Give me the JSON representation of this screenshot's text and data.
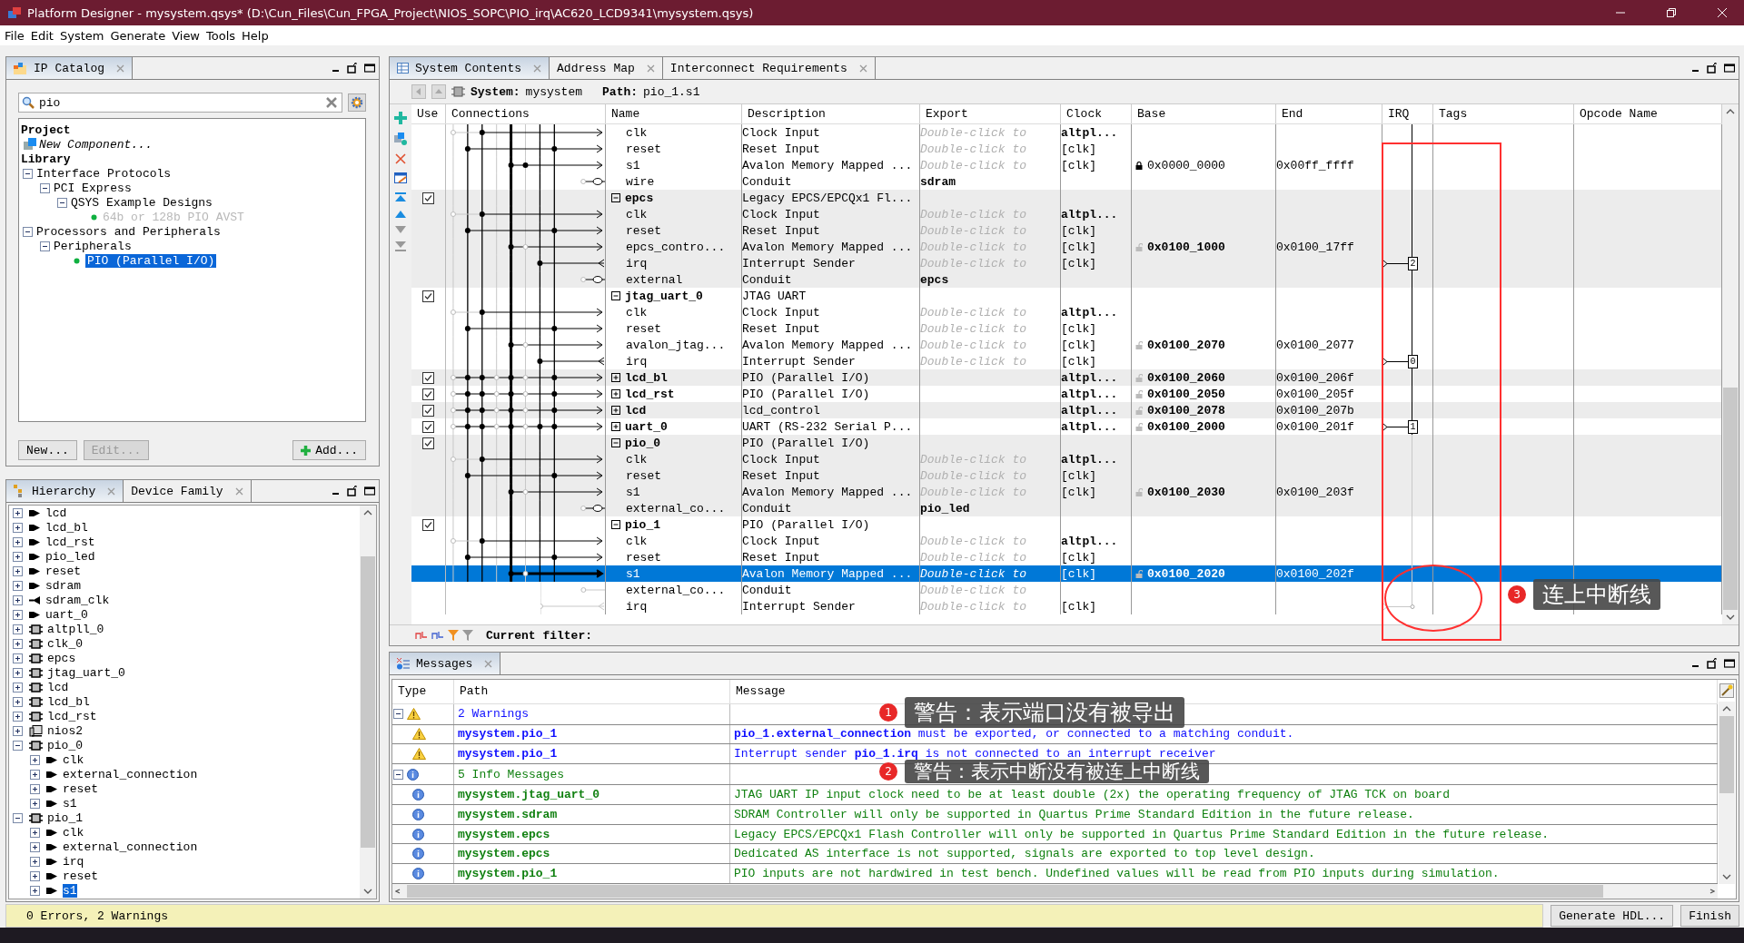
{
  "window": {
    "title": "Platform Designer - mysystem.qsys* (D:\\Cun_Files\\Cun_FPGA_Project\\NIOS_SOPC\\PIO_irq\\AC620_LCD9341\\mysystem.qsys)"
  },
  "menu": [
    "File",
    "Edit",
    "System",
    "Generate",
    "View",
    "Tools",
    "Help"
  ],
  "ip_catalog": {
    "tab": "IP Catalog",
    "search": {
      "value": "pio"
    },
    "tree": [
      {
        "label": "Project",
        "kind": "heading",
        "children": [
          {
            "label": "New Component...",
            "kind": "new"
          }
        ]
      },
      {
        "label": "Library",
        "kind": "heading",
        "children": [
          {
            "label": "Interface Protocols",
            "kind": "folder",
            "expanded": true,
            "children": [
              {
                "label": "PCI Express",
                "kind": "folder",
                "expanded": true,
                "children": [
                  {
                    "label": "QSYS Example Designs",
                    "kind": "folder",
                    "expanded": true,
                    "children": [
                      {
                        "label": "64b or 128b PIO AVST",
                        "kind": "ip",
                        "disabled": true,
                        "selected": false
                      }
                    ]
                  }
                ]
              }
            ]
          },
          {
            "label": "Processors and Peripherals",
            "kind": "folder",
            "expanded": true,
            "children": [
              {
                "label": "Peripherals",
                "kind": "folder",
                "expanded": true,
                "children": [
                  {
                    "label": "PIO (Parallel I/O)",
                    "kind": "ip",
                    "disabled": false,
                    "selected": true
                  }
                ]
              }
            ]
          }
        ]
      }
    ],
    "buttons": [
      {
        "label": "New...",
        "kind": "plain",
        "disabled": false
      },
      {
        "label": "Edit...",
        "kind": "plain",
        "disabled": true
      },
      {
        "label": "Add...",
        "kind": "add",
        "disabled": false
      }
    ]
  },
  "hierarchy": {
    "tabs": [
      {
        "label": "Hierarchy",
        "selected": true
      },
      {
        "label": "Device Family",
        "selected": false
      }
    ],
    "items": [
      {
        "label": "lcd",
        "kind": "export_in",
        "expanded": false,
        "selected": false
      },
      {
        "label": "lcd_bl",
        "kind": "export_in",
        "expanded": false,
        "selected": false
      },
      {
        "label": "lcd_rst",
        "kind": "export_in",
        "expanded": false,
        "selected": false
      },
      {
        "label": "pio_led",
        "kind": "export_in",
        "expanded": false,
        "selected": false
      },
      {
        "label": "reset",
        "kind": "export_in",
        "expanded": false,
        "selected": false
      },
      {
        "label": "sdram",
        "kind": "export_in",
        "expanded": false,
        "selected": false
      },
      {
        "label": "sdram_clk",
        "kind": "export_out",
        "expanded": false,
        "selected": false
      },
      {
        "label": "uart_0",
        "kind": "export_in",
        "expanded": false,
        "selected": false
      },
      {
        "label": "altpll_0",
        "kind": "module",
        "expanded": false,
        "selected": false
      },
      {
        "label": "clk_0",
        "kind": "module",
        "expanded": false,
        "selected": false
      },
      {
        "label": "epcs",
        "kind": "module",
        "expanded": false,
        "selected": false
      },
      {
        "label": "jtag_uart_0",
        "kind": "module",
        "expanded": false,
        "selected": false
      },
      {
        "label": "lcd",
        "kind": "module",
        "expanded": false,
        "selected": false
      },
      {
        "label": "lcd_bl",
        "kind": "module",
        "expanded": false,
        "selected": false
      },
      {
        "label": "lcd_rst",
        "kind": "module",
        "expanded": false,
        "selected": false
      },
      {
        "label": "nios2",
        "kind": "cpu",
        "expanded": false,
        "selected": false
      },
      {
        "label": "pio_0",
        "kind": "module",
        "expanded": true,
        "selected": false,
        "children": [
          {
            "label": "clk",
            "kind": "export_in",
            "expanded": false,
            "selected": false
          },
          {
            "label": "external_connection",
            "kind": "export_in",
            "expanded": false,
            "selected": false
          },
          {
            "label": "reset",
            "kind": "export_in",
            "expanded": false,
            "selected": false
          },
          {
            "label": "s1",
            "kind": "export_in",
            "expanded": false,
            "selected": false
          }
        ]
      },
      {
        "label": "pio_1",
        "kind": "module",
        "expanded": true,
        "selected": false,
        "children": [
          {
            "label": "clk",
            "kind": "export_in",
            "expanded": false,
            "selected": false
          },
          {
            "label": "external_connection",
            "kind": "export_in",
            "expanded": false,
            "selected": false
          },
          {
            "label": "irq",
            "kind": "export_in",
            "expanded": false,
            "selected": false
          },
          {
            "label": "reset",
            "kind": "export_in",
            "expanded": false,
            "selected": false
          },
          {
            "label": "s1",
            "kind": "export_in",
            "expanded": false,
            "selected": true
          }
        ]
      }
    ]
  },
  "system": {
    "tabs": [
      {
        "label": "System Contents",
        "selected": true
      },
      {
        "label": "Address Map",
        "selected": false
      },
      {
        "label": "Interconnect Requirements",
        "selected": false
      }
    ],
    "system_label": "System:",
    "system_name": "mysystem",
    "path_label": "Path:",
    "path": "pio_1.s1",
    "columns": [
      "Use",
      "Connections",
      "Name",
      "Description",
      "Export",
      "Clock",
      "Base",
      "End",
      "IRQ",
      "Tags",
      "Opcode Name"
    ],
    "rows": [
      {
        "kind": "clock",
        "name": "clk",
        "description": "Clock Input",
        "export": "Double-click to",
        "exported": false,
        "clock": "altpl...",
        "selected": false
      },
      {
        "kind": "reset",
        "name": "reset",
        "description": "Reset Input",
        "export": "Double-click to",
        "exported": false,
        "clock": "[clk]",
        "selected": false
      },
      {
        "kind": "avalon",
        "name": "s1",
        "description": "Avalon Memory Mapped ...",
        "export": "Double-click to",
        "exported": false,
        "clock": "[clk]",
        "locked": true,
        "base": "0x0000_0000",
        "end": "0x00ff_ffff",
        "selected": false
      },
      {
        "kind": "conduit",
        "name": "wire",
        "description": "Conduit",
        "export": "sdram",
        "exported": true,
        "selected": false
      },
      {
        "kind": "module",
        "name": "epcs",
        "description": "Legacy EPCS/EPCQx1 Fl...",
        "use": true,
        "expanded": true,
        "selected": false
      },
      {
        "kind": "clock",
        "name": "clk",
        "description": "Clock Input",
        "export": "Double-click to",
        "exported": false,
        "clock": "altpl...",
        "selected": false
      },
      {
        "kind": "reset",
        "name": "reset",
        "description": "Reset Input",
        "export": "Double-click to",
        "exported": false,
        "clock": "[clk]",
        "selected": false
      },
      {
        "kind": "avalon",
        "name": "epcs_contro...",
        "description": "Avalon Memory Mapped ...",
        "export": "Double-click to",
        "exported": false,
        "clock": "[clk]",
        "locked": false,
        "base": "0x0100_1000",
        "end": "0x0100_17ff",
        "selected": false
      },
      {
        "kind": "interrupt",
        "name": "irq",
        "description": "Interrupt Sender",
        "export": "Double-click to",
        "exported": false,
        "clock": "[clk]",
        "irq": "2",
        "selected": false
      },
      {
        "kind": "conduit",
        "name": "external",
        "description": "Conduit",
        "export": "epcs",
        "exported": true,
        "selected": false
      },
      {
        "kind": "module",
        "name": "jtag_uart_0",
        "description": "JTAG UART",
        "use": true,
        "expanded": true,
        "selected": false
      },
      {
        "kind": "clock",
        "name": "clk",
        "description": "Clock Input",
        "export": "Double-click to",
        "exported": false,
        "clock": "altpl...",
        "selected": false
      },
      {
        "kind": "reset",
        "name": "reset",
        "description": "Reset Input",
        "export": "Double-click to",
        "exported": false,
        "clock": "[clk]",
        "selected": false
      },
      {
        "kind": "avalon",
        "name": "avalon_jtag...",
        "description": "Avalon Memory Mapped ...",
        "export": "Double-click to",
        "exported": false,
        "clock": "[clk]",
        "locked": false,
        "base": "0x0100_2070",
        "end": "0x0100_2077",
        "selected": false
      },
      {
        "kind": "interrupt",
        "name": "irq",
        "description": "Interrupt Sender",
        "export": "Double-click to",
        "exported": false,
        "clock": "[clk]",
        "irq": "0",
        "selected": false
      },
      {
        "kind": "module",
        "name": "lcd_bl",
        "description": "PIO (Parallel I/O)",
        "use": true,
        "expanded": false,
        "clock": "altpl...",
        "locked": false,
        "base": "0x0100_2060",
        "end": "0x0100_206f",
        "selected": false
      },
      {
        "kind": "module",
        "name": "lcd_rst",
        "description": "PIO (Parallel I/O)",
        "use": true,
        "expanded": false,
        "clock": "altpl...",
        "locked": false,
        "base": "0x0100_2050",
        "end": "0x0100_205f",
        "selected": false
      },
      {
        "kind": "module",
        "name": "lcd",
        "description": "lcd_control",
        "use": true,
        "expanded": false,
        "clock": "altpl...",
        "locked": false,
        "base": "0x0100_2078",
        "end": "0x0100_207b",
        "selected": false
      },
      {
        "kind": "module",
        "name": "uart_0",
        "description": "UART (RS-232 Serial P...",
        "use": true,
        "expanded": false,
        "clock": "altpl...",
        "locked": false,
        "base": "0x0100_2000",
        "end": "0x0100_201f",
        "irq": "1",
        "selected": false
      },
      {
        "kind": "module",
        "name": "pio_0",
        "description": "PIO (Parallel I/O)",
        "use": true,
        "expanded": true,
        "selected": false
      },
      {
        "kind": "clock",
        "name": "clk",
        "description": "Clock Input",
        "export": "Double-click to",
        "exported": false,
        "clock": "altpl...",
        "selected": false
      },
      {
        "kind": "reset",
        "name": "reset",
        "description": "Reset Input",
        "export": "Double-click to",
        "exported": false,
        "clock": "[clk]",
        "selected": false
      },
      {
        "kind": "avalon",
        "name": "s1",
        "description": "Avalon Memory Mapped ...",
        "export": "Double-click to",
        "exported": false,
        "clock": "[clk]",
        "locked": false,
        "base": "0x0100_2030",
        "end": "0x0100_203f",
        "selected": false
      },
      {
        "kind": "conduit",
        "name": "external_co...",
        "description": "Conduit",
        "export": "pio_led",
        "exported": true,
        "selected": false
      },
      {
        "kind": "module",
        "name": "pio_1",
        "description": "PIO (Parallel I/O)",
        "use": true,
        "expanded": true,
        "selected": false
      },
      {
        "kind": "clock",
        "name": "clk",
        "description": "Clock Input",
        "export": "Double-click to",
        "exported": false,
        "clock": "altpl...",
        "selected": false
      },
      {
        "kind": "reset",
        "name": "reset",
        "description": "Reset Input",
        "export": "Double-click to",
        "exported": false,
        "clock": "[clk]",
        "selected": false
      },
      {
        "kind": "avalon",
        "name": "s1",
        "description": "Avalon Memory Mapped ...",
        "export": "Double-click to",
        "exported": false,
        "clock": "[clk]",
        "locked": false,
        "base": "0x0100_2020",
        "end": "0x0100_202f",
        "selected": true
      },
      {
        "kind": "conduit",
        "name": "external_co...",
        "description": "Conduit",
        "export": "Double-click to",
        "exported": false,
        "selected": false
      },
      {
        "kind": "interrupt",
        "name": "irq",
        "description": "Interrupt Sender",
        "export": "Double-click to",
        "exported": false,
        "clock": "[clk]",
        "selected": false
      }
    ],
    "filter_label": "Current filter:"
  },
  "messages": {
    "tab": "Messages",
    "columns": [
      "Type",
      "Path",
      "Message"
    ],
    "groups": [
      {
        "kind": "warning",
        "label": "2 Warnings",
        "expanded": true,
        "items": [
          {
            "path": "mysystem.pio_1",
            "message": "**pio_1.external_connection** must be exported, or connected to a matching conduit."
          },
          {
            "path": "mysystem.pio_1",
            "message": "Interrupt sender **pio_1.irq** is not connected to an interrupt receiver"
          }
        ]
      },
      {
        "kind": "info",
        "label": "5 Info Messages",
        "expanded": true,
        "items": [
          {
            "path": "mysystem.jtag_uart_0",
            "message": "JTAG UART IP input clock need to be at least double (2x) the operating frequency of JTAG TCK on board"
          },
          {
            "path": "mysystem.sdram",
            "message": "SDRAM Controller will only be supported in Quartus Prime Standard Edition in the future release."
          },
          {
            "path": "mysystem.epcs",
            "message": "Legacy EPCS/EPCQx1 Flash Controller will only be supported in Quartus Prime Standard Edition in the future release."
          },
          {
            "path": "mysystem.epcs",
            "message": "Dedicated AS interface is not supported, signals are exported to top level design."
          },
          {
            "path": "mysystem.pio_1",
            "message": "PIO inputs are not hardwired in test bench. Undefined values will be read from PIO inputs during simulation."
          }
        ]
      }
    ]
  },
  "status": "0 Errors, 2 Warnings",
  "buttons": [
    "Generate HDL...",
    "Finish"
  ],
  "annotations": [
    {
      "number": "1",
      "text": "警告：表示端口没有被导出"
    },
    {
      "number": "2",
      "text": "警告：表示中断没有被连上中断线"
    },
    {
      "number": "3",
      "text": "连上中断线"
    }
  ]
}
